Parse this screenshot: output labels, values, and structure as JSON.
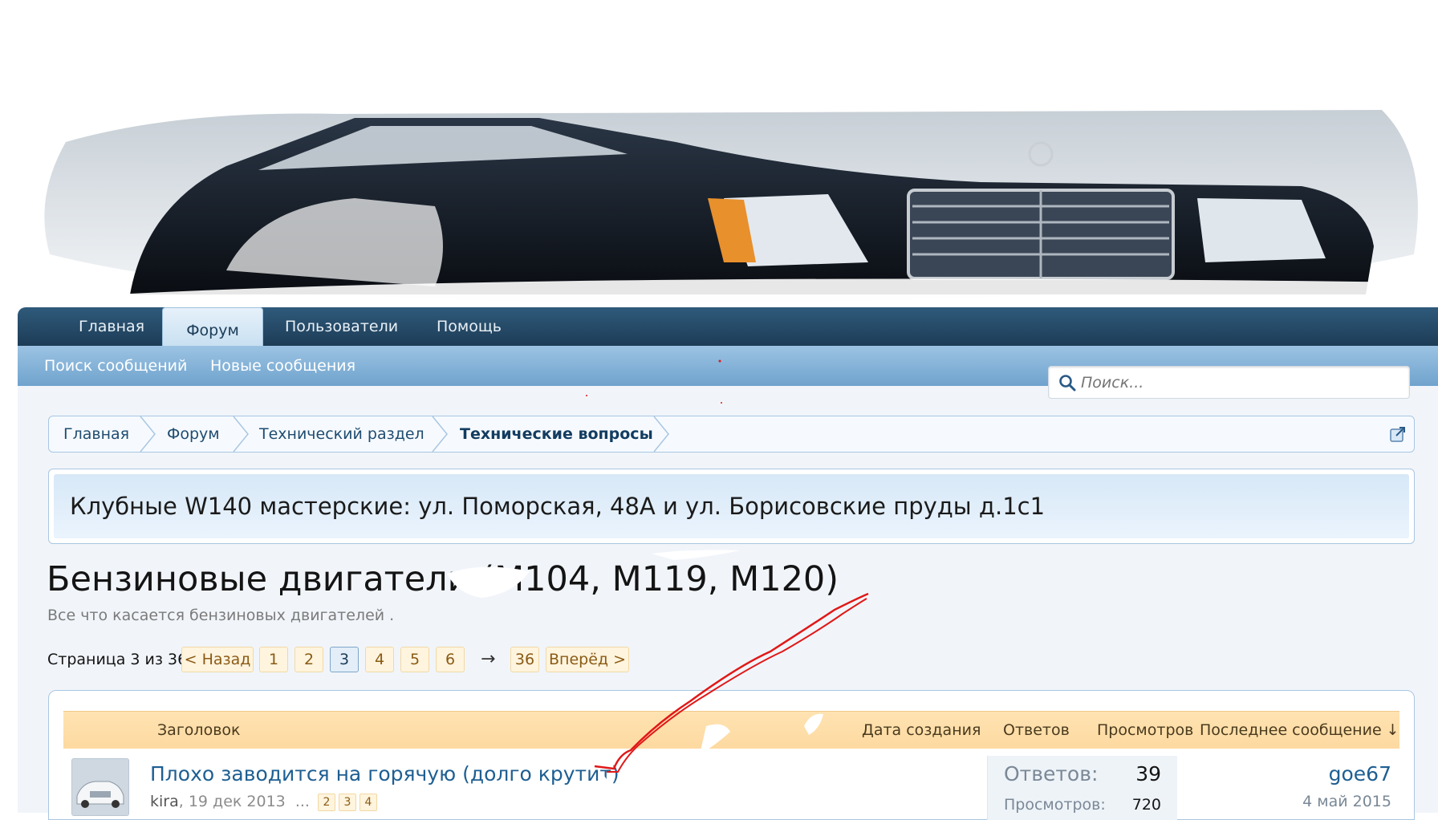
{
  "nav": {
    "tabs": [
      "Главная",
      "Форум",
      "Пользователи",
      "Помощь"
    ],
    "active": "Форум"
  },
  "subnav": [
    "Поиск сообщений",
    "Новые сообщения"
  ],
  "search": {
    "placeholder": "Поиск..."
  },
  "breadcrumb": [
    "Главная",
    "Форум",
    "Технический раздел",
    "Технические вопросы"
  ],
  "notice": "Клубные W140 мастерские: ул. Поморская, 48А и ул. Борисовские пруды д.1с1",
  "forum": {
    "title_visible_tail": "M119, M120)",
    "title_visible_head": "Бензиновые двигатели (",
    "title_obscured": "M104",
    "description": "Все что касается бензиновых двигателей ."
  },
  "pagination": {
    "label": "Страница 3 из 36",
    "prev": "< Назад",
    "pages": [
      "1",
      "2",
      "3",
      "4",
      "5",
      "6"
    ],
    "current": "3",
    "arrow": "→",
    "last": "36",
    "next": "Вперёд >"
  },
  "columns": {
    "title": "Заголовок",
    "created": "Дата создания",
    "replies": "Ответов",
    "views": "Просмотров",
    "last": "Последнее сообщение ↓"
  },
  "threads": [
    {
      "title": "Плохо заводится на горячую (долго крутит)",
      "author": "kira",
      "date": "19 дек 2013",
      "ellipsis": "...",
      "pages": [
        "2",
        "3",
        "4"
      ],
      "replies_label": "Ответов:",
      "replies": "39",
      "views_label": "Просмотров:",
      "views": "720",
      "last_user": "goe67",
      "last_date": "4 май 2015"
    }
  ],
  "colors": {
    "nav_dark": "#1d3c56",
    "nav_light": "#6fa3cd",
    "link": "#1e5f92",
    "header_bar": "#fdd9a0",
    "annotation": "#e01818"
  },
  "icons": [
    "search-icon",
    "jump-icon",
    "car-banner-image"
  ]
}
